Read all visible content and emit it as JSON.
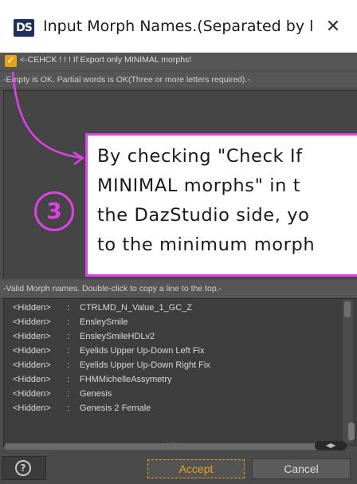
{
  "window": {
    "app_icon": "DS",
    "title": "Input Morph Names.(Separated by l...",
    "close_icon": "✕"
  },
  "options": {
    "minimal_checked": true,
    "minimal_label": "<-CEHCK ! ! ! If Export only MINIMAL morphs!",
    "hint": "-Empty is OK. Partial words is OK(Three or more letters required).-"
  },
  "annotation": {
    "step": "3",
    "lines": [
      "By checking \"Check If",
      "MINIMAL morphs\" in t",
      "the DazStudio side, yo",
      "to the minimum morph"
    ],
    "accent_color": "#e040e8"
  },
  "morph_list": {
    "header": "-Valid Morph names. Double-click to copy a line to the top.-",
    "rows": [
      {
        "status": "<Hidden>",
        "sep": ":",
        "name": "CTRLMD_N_Value_1_GC_Z"
      },
      {
        "status": "<Hidden>",
        "sep": ":",
        "name": "EnsleySmile"
      },
      {
        "status": "<Hidden>",
        "sep": ":",
        "name": "EnsleySmileHDLv2"
      },
      {
        "status": "<Hidden>",
        "sep": ":",
        "name": "Eyelids Upper Up-Down Left Fix"
      },
      {
        "status": "<Hidden>",
        "sep": ":",
        "name": "Eyelids Upper Up-Down Right Fix"
      },
      {
        "status": "<Hidden>",
        "sep": ":",
        "name": "FHMMichelleAssymetry"
      },
      {
        "status": "<Hidden>",
        "sep": ":",
        "name": "Genesis"
      },
      {
        "status": "<Hidden>",
        "sep": ":",
        "name": "Genesis 2 Female"
      }
    ]
  },
  "buttons": {
    "help_icon": "?",
    "accept": "Accept",
    "cancel": "Cancel"
  },
  "colors": {
    "accent": "#e8a21a",
    "annotation": "#e040e8"
  }
}
